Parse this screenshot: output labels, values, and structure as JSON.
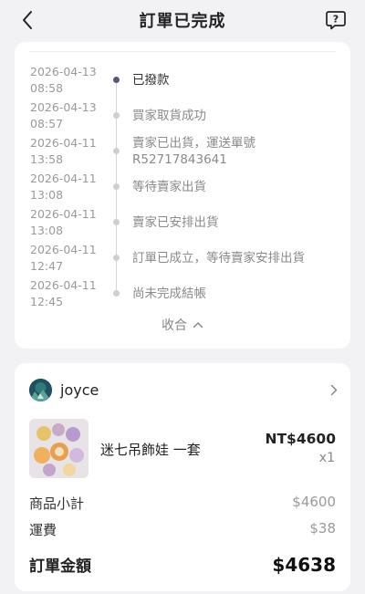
{
  "header": {
    "title": "訂單已完成"
  },
  "timeline": {
    "events": [
      {
        "date": "2026-04-13",
        "time": "08:58",
        "status": "已撥款",
        "active": true
      },
      {
        "date": "2026-04-13",
        "time": "08:57",
        "status": "買家取貨成功",
        "active": false
      },
      {
        "date": "2026-04-11",
        "time": "13:58",
        "status": "賣家已出貨，運送單號",
        "status2": "R52717843641",
        "active": false
      },
      {
        "date": "2026-04-11",
        "time": "13:08",
        "status": "等待賣家出貨",
        "active": false
      },
      {
        "date": "2026-04-11",
        "time": "13:08",
        "status": "賣家已安排出貨",
        "active": false
      },
      {
        "date": "2026-04-11",
        "time": "12:47",
        "status": "訂單已成立，等待賣家安排出貨",
        "active": false
      },
      {
        "date": "2026-04-11",
        "time": "12:45",
        "status": "尚未完成結帳",
        "active": false
      }
    ],
    "collapse_label": "收合"
  },
  "order": {
    "seller_name": "joyce",
    "product": {
      "name": "迷七吊飾娃 一套",
      "price": "NT$4600",
      "qty": "x1"
    },
    "subtotal_label": "商品小計",
    "subtotal_value": "$4600",
    "shipping_label": "運費",
    "shipping_value": "$38",
    "total_label": "訂單金額",
    "total_value": "$4638"
  },
  "colors": {
    "background": "#f2f2f5",
    "card": "#ffffff",
    "active_dot": "#555a72"
  },
  "icons": [
    "chevron-left-icon",
    "help-question-icon",
    "chevron-up-icon",
    "chevron-right-icon"
  ]
}
